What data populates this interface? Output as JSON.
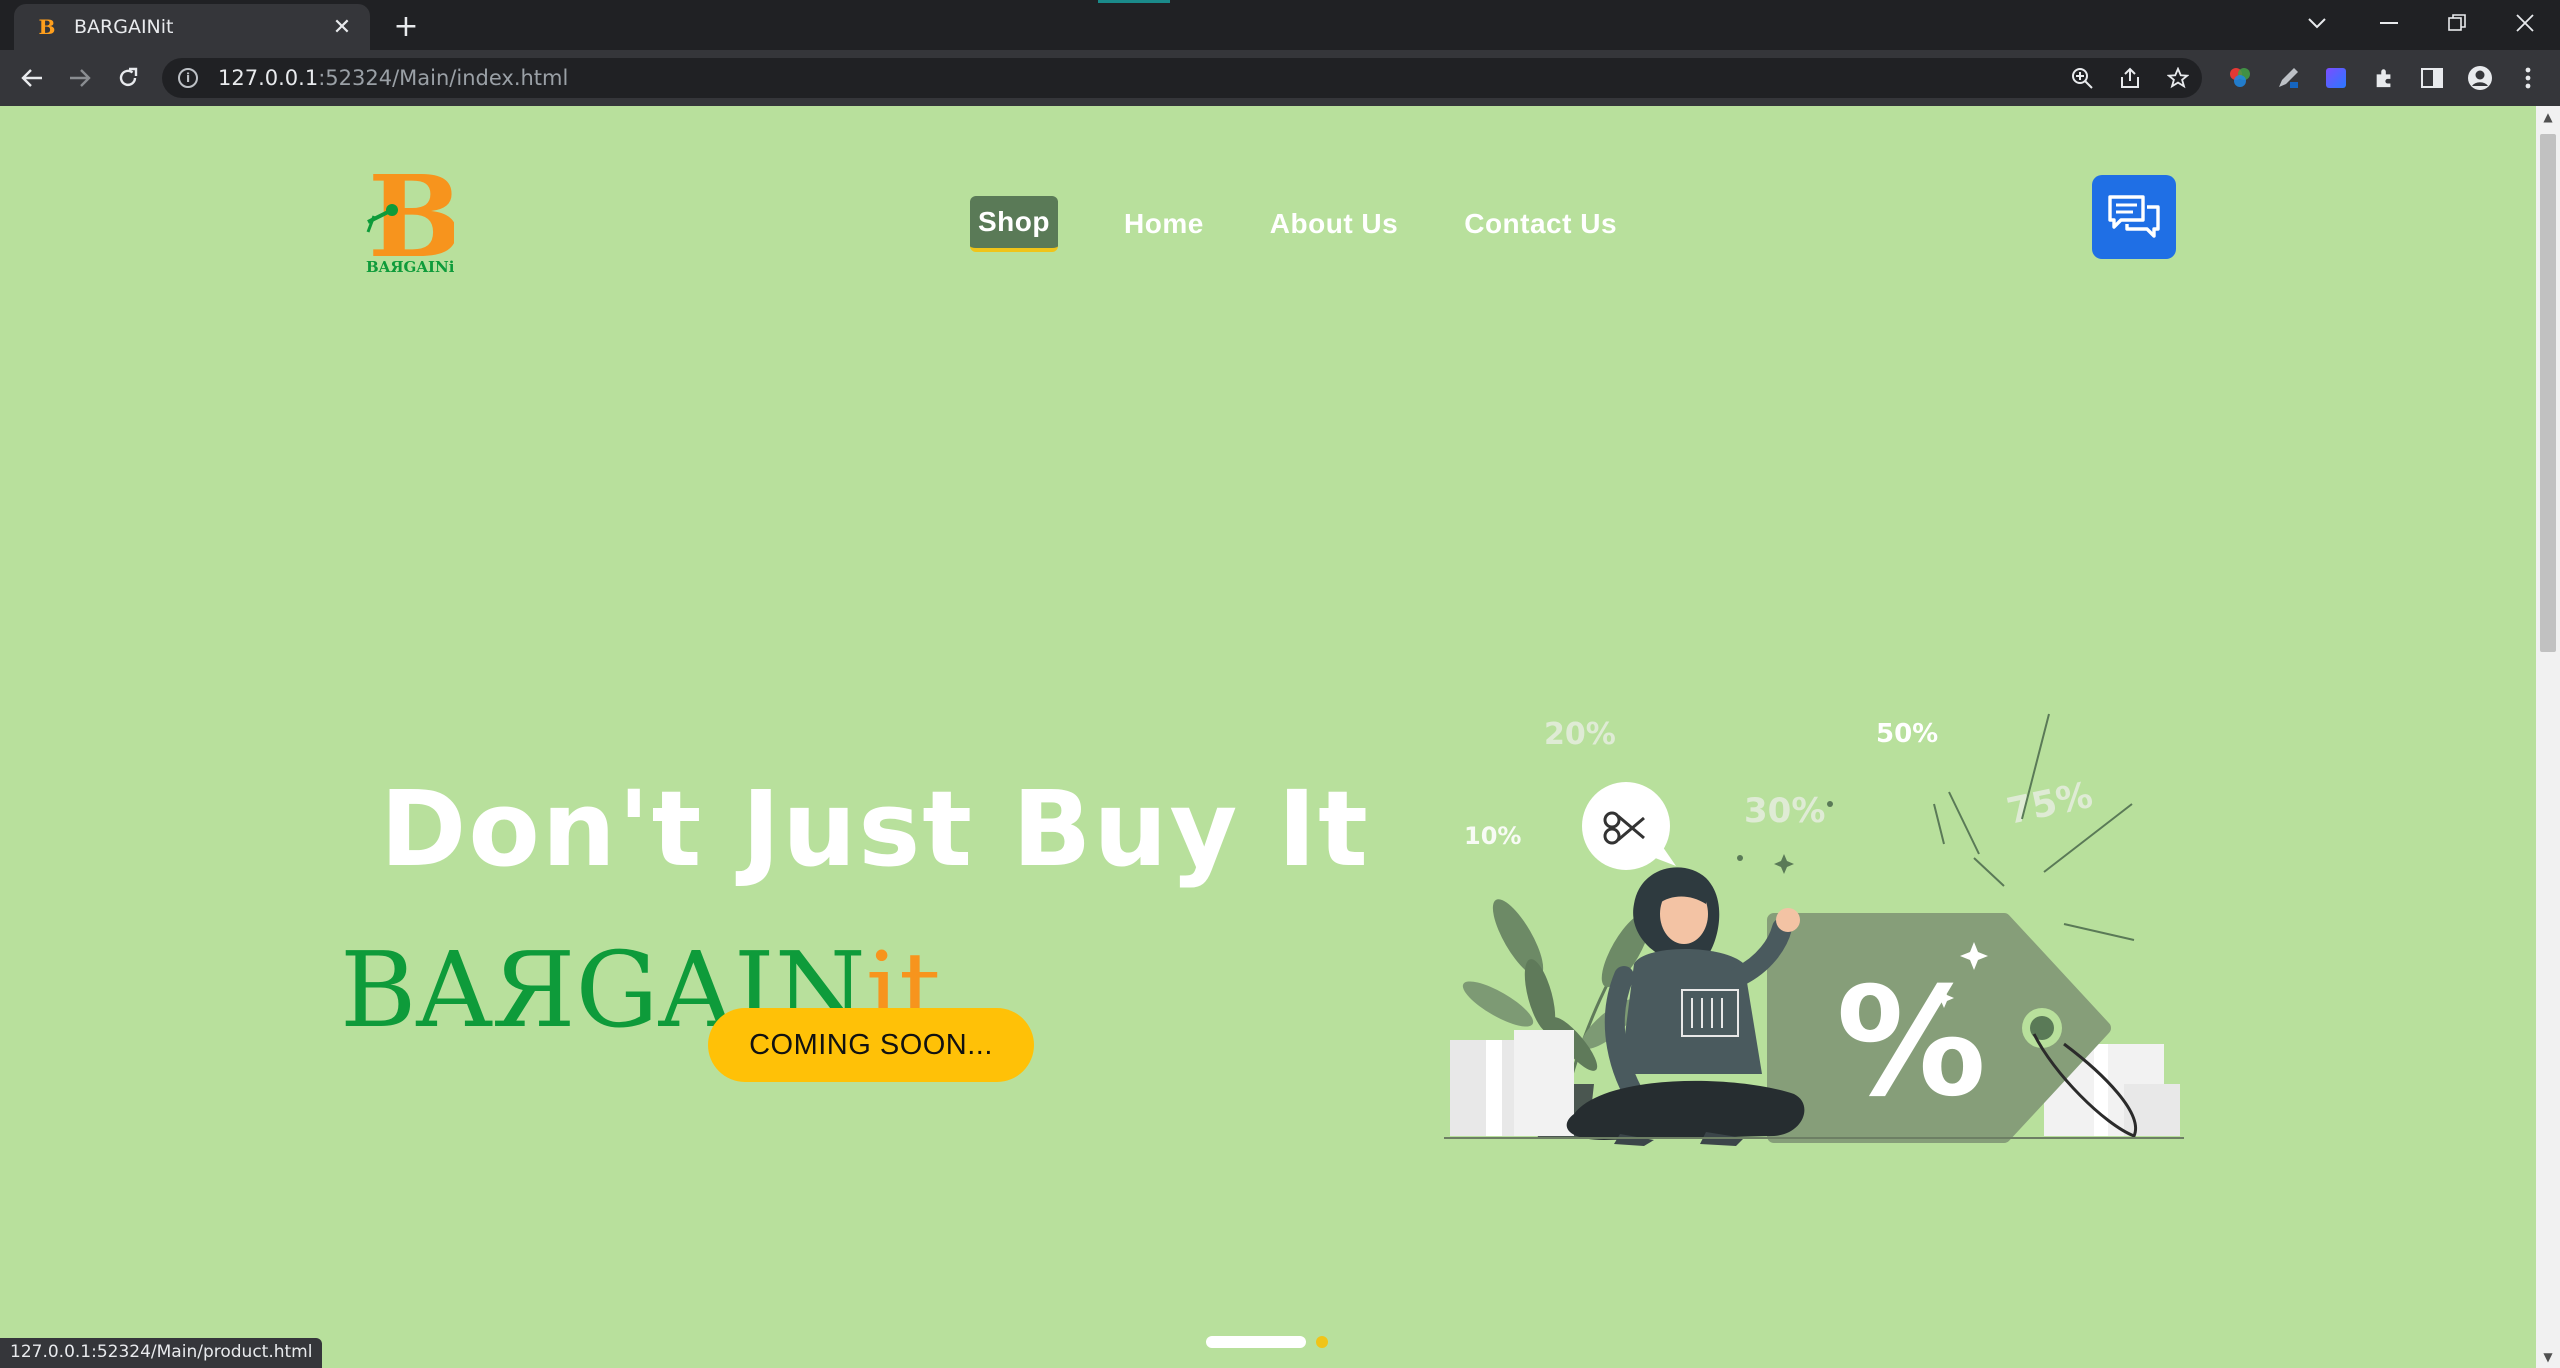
{
  "browser": {
    "tab_title": "BARGAINit",
    "tab_favicon_letter": "B",
    "url_host": "127.0.0.1",
    "url_rest": ":52324/Main/index.html",
    "status_url": "127.0.0.1:52324/Main/product.html"
  },
  "nav": {
    "items": [
      {
        "label": "Shop",
        "active": true
      },
      {
        "label": "Home"
      },
      {
        "label": "About Us"
      },
      {
        "label": "Contact Us"
      }
    ]
  },
  "logo": {
    "letter": "B",
    "wordmark": "BAЯGAINit"
  },
  "hero": {
    "headline": "Don't Just Buy It",
    "brand_main": "BAЯGAIN",
    "brand_suffix": "it",
    "cta_label": "COMING SOON...",
    "discount_labels": [
      "10%",
      "20%",
      "30%",
      "50%",
      "75%"
    ],
    "tag_symbol": "%"
  },
  "carousel": {
    "slides": 2,
    "active": 1
  },
  "colors": {
    "page_bg": "#b8e09c",
    "brand_green": "#0e9b3a",
    "brand_orange": "#f7941d",
    "cta": "#ffc107",
    "chat_button": "#1f6fe5",
    "nav_active_bg": "#5a7a57"
  }
}
